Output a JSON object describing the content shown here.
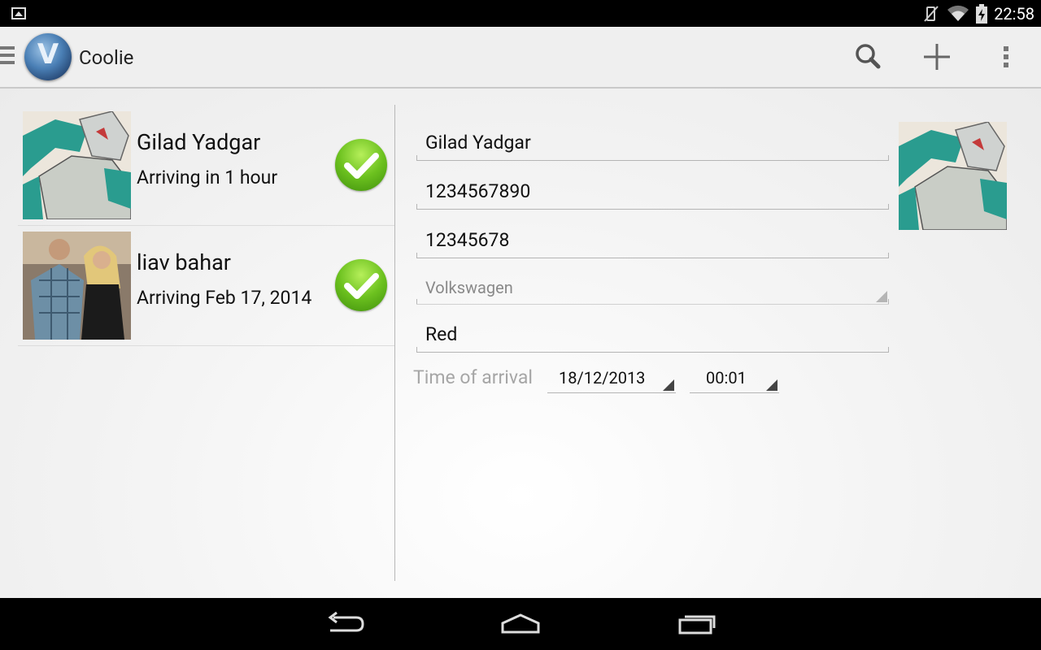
{
  "status_bar": {
    "time": "22:58",
    "icons": [
      "gallery-icon",
      "vibrate-off-icon",
      "wifi-icon",
      "battery-charging-icon"
    ]
  },
  "action_bar": {
    "title": "Coolie",
    "icons": [
      "drawer-icon",
      "app-logo",
      "search-icon",
      "add-icon",
      "overflow-menu-icon"
    ]
  },
  "list": {
    "items": [
      {
        "name": "Gilad Yadgar",
        "status": "Arriving in 1 hour",
        "icon": "check-icon"
      },
      {
        "name": "liav bahar",
        "status": "Arriving Feb 17, 2014",
        "icon": "check-icon"
      }
    ]
  },
  "detail": {
    "name": "Gilad Yadgar",
    "phone": "1234567890",
    "id_number": "12345678",
    "car_make": "Volkswagen",
    "car_color": "Red",
    "arrival_label": "Time of arrival",
    "arrival_date": "18/12/2013",
    "arrival_time": "00:01"
  },
  "nav_bar": {
    "icons": [
      "back-icon",
      "home-icon",
      "recent-apps-icon"
    ]
  }
}
